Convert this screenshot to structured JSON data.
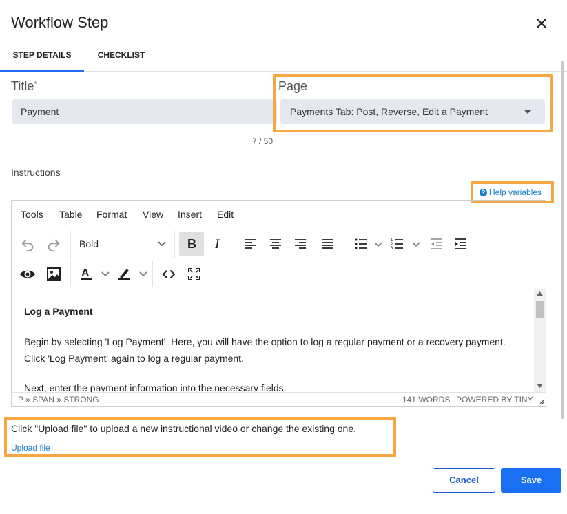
{
  "dialog": {
    "title": "Workflow Step"
  },
  "tabs": [
    {
      "label": "STEP DETAILS",
      "active": true
    },
    {
      "label": "CHECKLIST",
      "active": false
    }
  ],
  "title_field": {
    "label": "Title",
    "required_mark": "*",
    "value": "Payment",
    "counter": "7 / 50"
  },
  "page_field": {
    "label": "Page",
    "value": "Payments Tab: Post, Reverse, Edit a Payment"
  },
  "instructions": {
    "label": "Instructions",
    "help_link": "Help variables",
    "menubar": [
      "Tools",
      "Table",
      "Format",
      "View",
      "Insert",
      "Edit"
    ],
    "format_select": "Bold",
    "content": {
      "heading": "Log a Payment",
      "para1": "Begin by selecting 'Log Payment'. Here, you will have the option to log a regular payment or a recovery payment. Click 'Log Payment' again to log a regular payment.",
      "para2": "Next, enter the payment information into the necessary fields:"
    },
    "status": {
      "path": "P » SPAN » STRONG",
      "words": "141 WORDS",
      "powered": "POWERED BY TINY"
    }
  },
  "upload": {
    "note": "Click \"Upload file\" to upload a new instructional video or change the existing one.",
    "link": "Upload file"
  },
  "actions": {
    "cancel": "Cancel",
    "save": "Save"
  },
  "colors": {
    "highlight": "#f5a742",
    "primary": "#1a6ff2",
    "link": "#1a7fc9",
    "input_bg": "#e5e9ef"
  }
}
